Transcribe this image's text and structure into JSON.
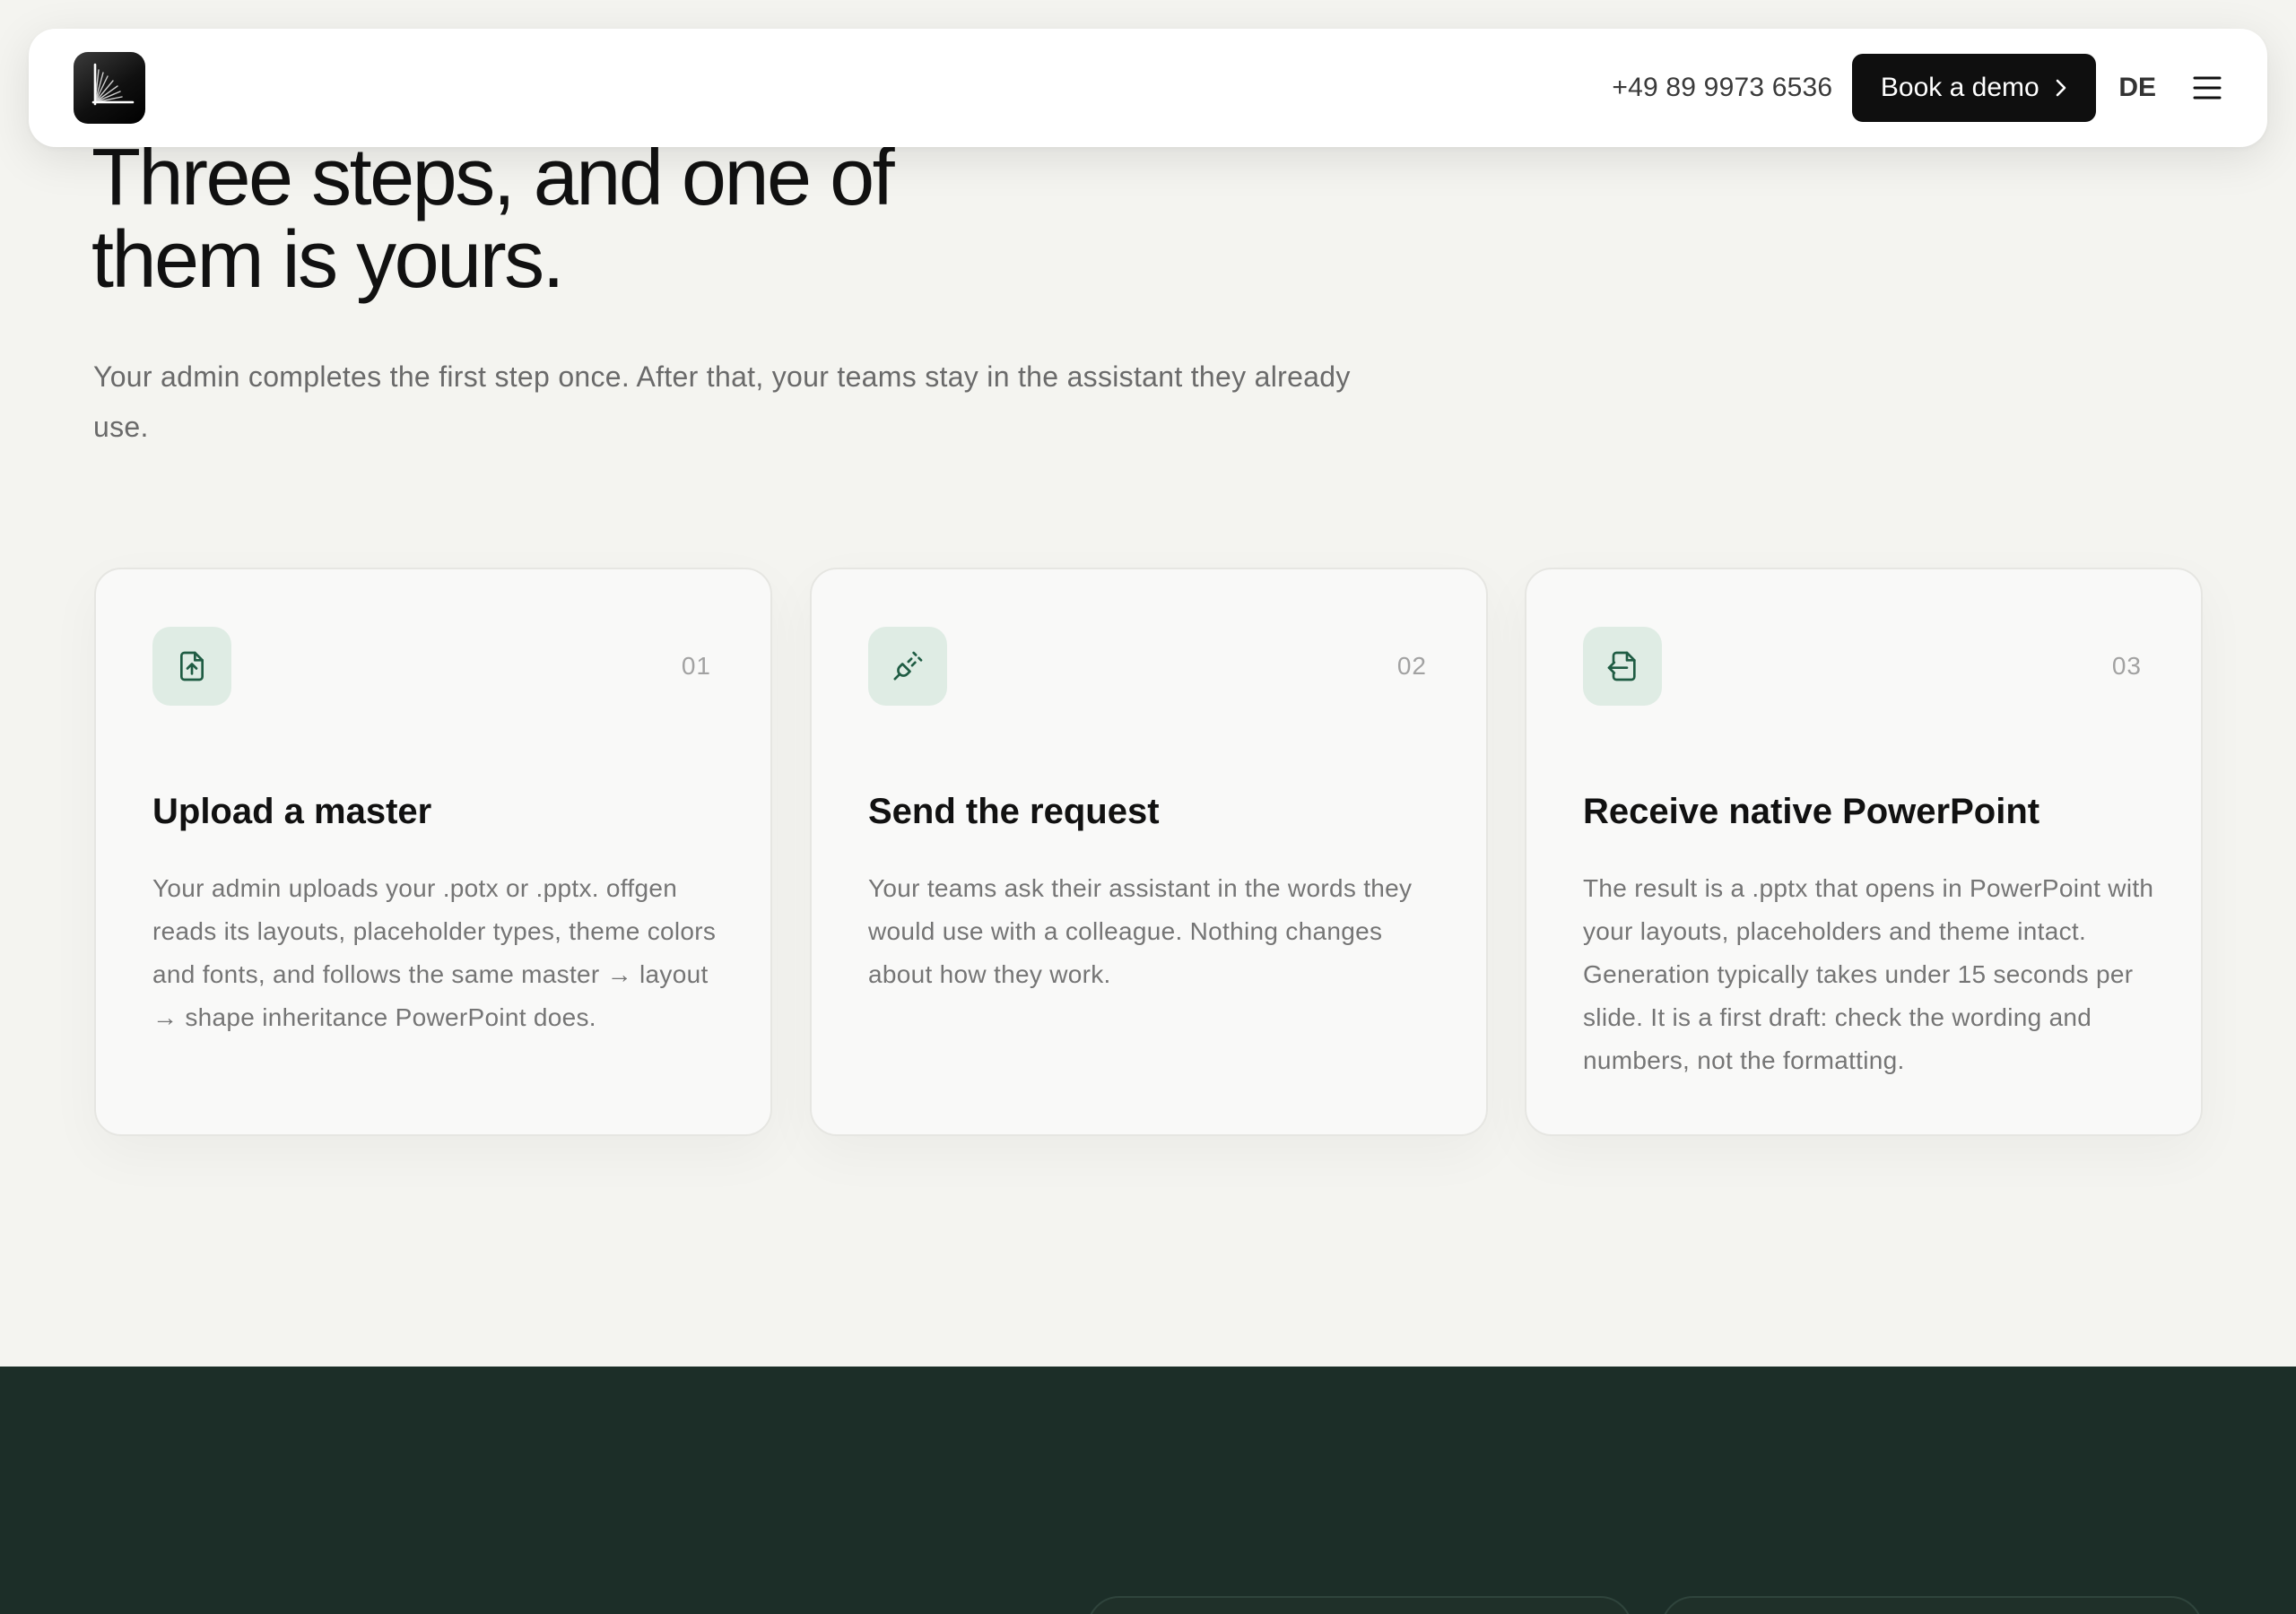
{
  "header": {
    "phone": "+49 89 9973 6536",
    "demo_label": "Book a demo",
    "lang": "DE"
  },
  "hero": {
    "title": "Three steps, and one of\nthem is yours.",
    "subtitle": "Your admin completes the first step once. After that, your teams stay in the assistant they already use."
  },
  "steps": [
    {
      "number": "01",
      "icon": "file-upload-icon",
      "title": "Upload a master",
      "body": "Your admin uploads your .potx or .pptx. offgen reads its layouts, placeholder types, theme colors and fonts, and follows the same master → layout → shape inheritance PowerPoint does."
    },
    {
      "number": "02",
      "icon": "plug-connect-icon",
      "title": "Send the request",
      "body": "Your teams ask their assistant in the words they would use with a colleague. Nothing changes about how they work."
    },
    {
      "number": "03",
      "icon": "file-import-icon",
      "title": "Receive native PowerPoint",
      "body": "The result is a .pptx that opens in PowerPoint with your layouts, placeholders and theme intact. Generation typically takes under 15 seconds per slide. It is a first draft: check the wording and numbers, not the formatting."
    }
  ],
  "colors": {
    "background": "#f4f4f0",
    "dark_section": "#1c2e28",
    "icon_tile": "#dfece4",
    "icon_stroke": "#1f5c43"
  }
}
